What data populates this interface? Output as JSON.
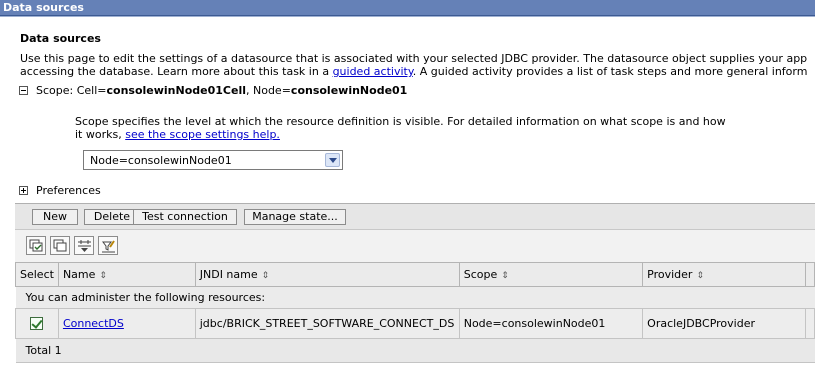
{
  "window": {
    "title": "Data sources"
  },
  "page": {
    "heading": "Data sources",
    "desc_line1": "Use this page to edit the settings of a datasource that is associated with your selected JDBC provider. The datasource object supplies your app",
    "desc_line2_prefix": "accessing the database. Learn more about this task in a ",
    "desc_link": "guided activity",
    "desc_line2_suffix": ". A guided activity provides a list of task steps and more general inform"
  },
  "scope": {
    "label": "Scope: Cell=",
    "cell": "consolewinNode01Cell",
    "node_label": ", Node=",
    "node": "consolewinNode01",
    "desc_prefix": "Scope specifies the level at which the resource definition is visible. For detailed information on what scope is and how it works, ",
    "help_link": "see the scope settings help.",
    "selected": "Node=consolewinNode01"
  },
  "preferences": {
    "label": "Preferences"
  },
  "toolbar": {
    "new": "New",
    "delete": "Delete",
    "test": "Test connection",
    "manage": "Manage state..."
  },
  "icons": [
    "select-all-icon",
    "deselect-all-icon",
    "filter-icon",
    "clear-filter-icon"
  ],
  "table": {
    "columns": [
      "Select",
      "Name",
      "JNDI name",
      "Scope",
      "Provider"
    ],
    "note": "You can administer the following resources:",
    "rows": [
      {
        "name": "ConnectDS",
        "jndi": "jdbc/BRICK_STREET_SOFTWARE_CONNECT_DS",
        "scope": "Node=consolewinNode01",
        "provider": "OracleJDBCProvider"
      }
    ],
    "total": "Total 1"
  },
  "colors": {
    "titlebar": "#6581b7",
    "link": "#0000cc"
  }
}
